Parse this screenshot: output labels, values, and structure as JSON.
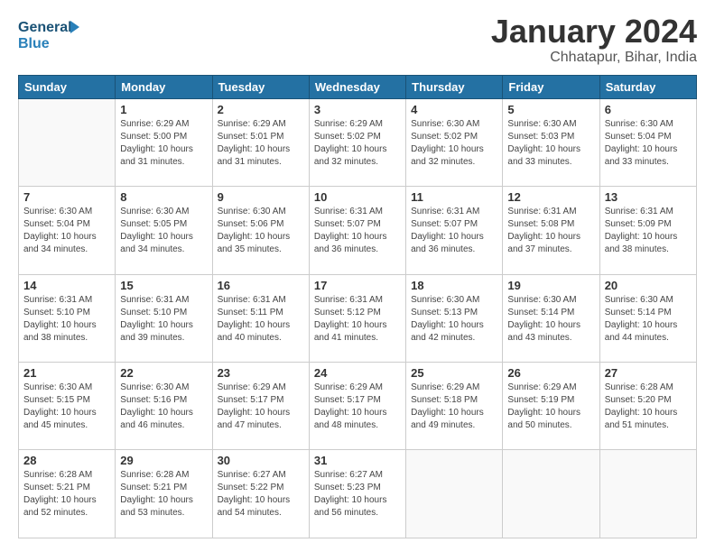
{
  "header": {
    "logo_line1": "General",
    "logo_line2": "Blue",
    "title": "January 2024",
    "subtitle": "Chhatapur, Bihar, India"
  },
  "weekdays": [
    "Sunday",
    "Monday",
    "Tuesday",
    "Wednesday",
    "Thursday",
    "Friday",
    "Saturday"
  ],
  "weeks": [
    [
      {
        "day": "",
        "info": ""
      },
      {
        "day": "1",
        "info": "Sunrise: 6:29 AM\nSunset: 5:00 PM\nDaylight: 10 hours\nand 31 minutes."
      },
      {
        "day": "2",
        "info": "Sunrise: 6:29 AM\nSunset: 5:01 PM\nDaylight: 10 hours\nand 31 minutes."
      },
      {
        "day": "3",
        "info": "Sunrise: 6:29 AM\nSunset: 5:02 PM\nDaylight: 10 hours\nand 32 minutes."
      },
      {
        "day": "4",
        "info": "Sunrise: 6:30 AM\nSunset: 5:02 PM\nDaylight: 10 hours\nand 32 minutes."
      },
      {
        "day": "5",
        "info": "Sunrise: 6:30 AM\nSunset: 5:03 PM\nDaylight: 10 hours\nand 33 minutes."
      },
      {
        "day": "6",
        "info": "Sunrise: 6:30 AM\nSunset: 5:04 PM\nDaylight: 10 hours\nand 33 minutes."
      }
    ],
    [
      {
        "day": "7",
        "info": "Sunrise: 6:30 AM\nSunset: 5:04 PM\nDaylight: 10 hours\nand 34 minutes."
      },
      {
        "day": "8",
        "info": "Sunrise: 6:30 AM\nSunset: 5:05 PM\nDaylight: 10 hours\nand 34 minutes."
      },
      {
        "day": "9",
        "info": "Sunrise: 6:30 AM\nSunset: 5:06 PM\nDaylight: 10 hours\nand 35 minutes."
      },
      {
        "day": "10",
        "info": "Sunrise: 6:31 AM\nSunset: 5:07 PM\nDaylight: 10 hours\nand 36 minutes."
      },
      {
        "day": "11",
        "info": "Sunrise: 6:31 AM\nSunset: 5:07 PM\nDaylight: 10 hours\nand 36 minutes."
      },
      {
        "day": "12",
        "info": "Sunrise: 6:31 AM\nSunset: 5:08 PM\nDaylight: 10 hours\nand 37 minutes."
      },
      {
        "day": "13",
        "info": "Sunrise: 6:31 AM\nSunset: 5:09 PM\nDaylight: 10 hours\nand 38 minutes."
      }
    ],
    [
      {
        "day": "14",
        "info": "Sunrise: 6:31 AM\nSunset: 5:10 PM\nDaylight: 10 hours\nand 38 minutes."
      },
      {
        "day": "15",
        "info": "Sunrise: 6:31 AM\nSunset: 5:10 PM\nDaylight: 10 hours\nand 39 minutes."
      },
      {
        "day": "16",
        "info": "Sunrise: 6:31 AM\nSunset: 5:11 PM\nDaylight: 10 hours\nand 40 minutes."
      },
      {
        "day": "17",
        "info": "Sunrise: 6:31 AM\nSunset: 5:12 PM\nDaylight: 10 hours\nand 41 minutes."
      },
      {
        "day": "18",
        "info": "Sunrise: 6:30 AM\nSunset: 5:13 PM\nDaylight: 10 hours\nand 42 minutes."
      },
      {
        "day": "19",
        "info": "Sunrise: 6:30 AM\nSunset: 5:14 PM\nDaylight: 10 hours\nand 43 minutes."
      },
      {
        "day": "20",
        "info": "Sunrise: 6:30 AM\nSunset: 5:14 PM\nDaylight: 10 hours\nand 44 minutes."
      }
    ],
    [
      {
        "day": "21",
        "info": "Sunrise: 6:30 AM\nSunset: 5:15 PM\nDaylight: 10 hours\nand 45 minutes."
      },
      {
        "day": "22",
        "info": "Sunrise: 6:30 AM\nSunset: 5:16 PM\nDaylight: 10 hours\nand 46 minutes."
      },
      {
        "day": "23",
        "info": "Sunrise: 6:29 AM\nSunset: 5:17 PM\nDaylight: 10 hours\nand 47 minutes."
      },
      {
        "day": "24",
        "info": "Sunrise: 6:29 AM\nSunset: 5:17 PM\nDaylight: 10 hours\nand 48 minutes."
      },
      {
        "day": "25",
        "info": "Sunrise: 6:29 AM\nSunset: 5:18 PM\nDaylight: 10 hours\nand 49 minutes."
      },
      {
        "day": "26",
        "info": "Sunrise: 6:29 AM\nSunset: 5:19 PM\nDaylight: 10 hours\nand 50 minutes."
      },
      {
        "day": "27",
        "info": "Sunrise: 6:28 AM\nSunset: 5:20 PM\nDaylight: 10 hours\nand 51 minutes."
      }
    ],
    [
      {
        "day": "28",
        "info": "Sunrise: 6:28 AM\nSunset: 5:21 PM\nDaylight: 10 hours\nand 52 minutes."
      },
      {
        "day": "29",
        "info": "Sunrise: 6:28 AM\nSunset: 5:21 PM\nDaylight: 10 hours\nand 53 minutes."
      },
      {
        "day": "30",
        "info": "Sunrise: 6:27 AM\nSunset: 5:22 PM\nDaylight: 10 hours\nand 54 minutes."
      },
      {
        "day": "31",
        "info": "Sunrise: 6:27 AM\nSunset: 5:23 PM\nDaylight: 10 hours\nand 56 minutes."
      },
      {
        "day": "",
        "info": ""
      },
      {
        "day": "",
        "info": ""
      },
      {
        "day": "",
        "info": ""
      }
    ]
  ]
}
